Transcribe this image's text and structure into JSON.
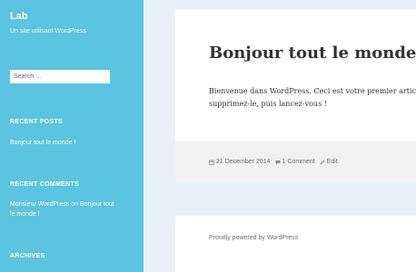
{
  "site": {
    "title": "Lab",
    "description": "Un site utilisant WordPress"
  },
  "search": {
    "placeholder": "Search …"
  },
  "widgets": {
    "recent_posts": {
      "title": "RECENT POSTS",
      "items": [
        "Bonjour tout le monde !"
      ]
    },
    "recent_comments": {
      "title": "RECENT COMMENTS",
      "author": "Monsieur WordPress",
      "on": "on",
      "post": "Bonjour tout le monde !"
    },
    "archives": {
      "title": "ARCHIVES"
    }
  },
  "post": {
    "title": "Bonjour tout le monde !",
    "body_line1": "Bienvenue dans WordPress. Ceci est votre premier article",
    "body_line2": "supprimez-le, puis lancez-vous !",
    "date": "21 December 2014",
    "comments": "1 Comment",
    "edit": "Edit"
  },
  "footer": {
    "text": "Proudly powered by WordPress"
  },
  "colors": {
    "sidebar": "#5bc4e0",
    "background": "#e8f1f9",
    "meta_background": "#f1f1f1"
  },
  "icons": {
    "date": "calendar-icon",
    "comments": "comment-icon",
    "edit": "pencil-icon"
  }
}
